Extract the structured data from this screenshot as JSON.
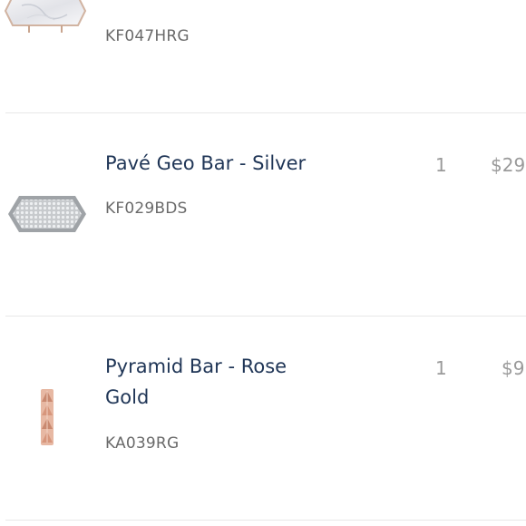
{
  "cart": {
    "items": [
      {
        "name": "",
        "sku": "KF047HRG",
        "thumbnail_icon": "white-stone-rose-gold-bar-icon",
        "accent": "#c9a58f"
      },
      {
        "name": "Pavé Geo Bar - Silver",
        "sku": "KF029BDS",
        "quantity": "1",
        "price": "$29",
        "thumbnail_icon": "pave-geo-bar-silver-icon",
        "accent": "#b8bcc0"
      },
      {
        "name": "Pyramid Bar - Rose Gold",
        "sku": "KA039RG",
        "quantity": "1",
        "price": "$9",
        "thumbnail_icon": "pyramid-bar-rose-gold-icon",
        "accent": "#d9a88f"
      }
    ]
  },
  "colors": {
    "title": "#1f3556",
    "muted": "#9a9a9a",
    "divider": "#e8e8e8"
  }
}
